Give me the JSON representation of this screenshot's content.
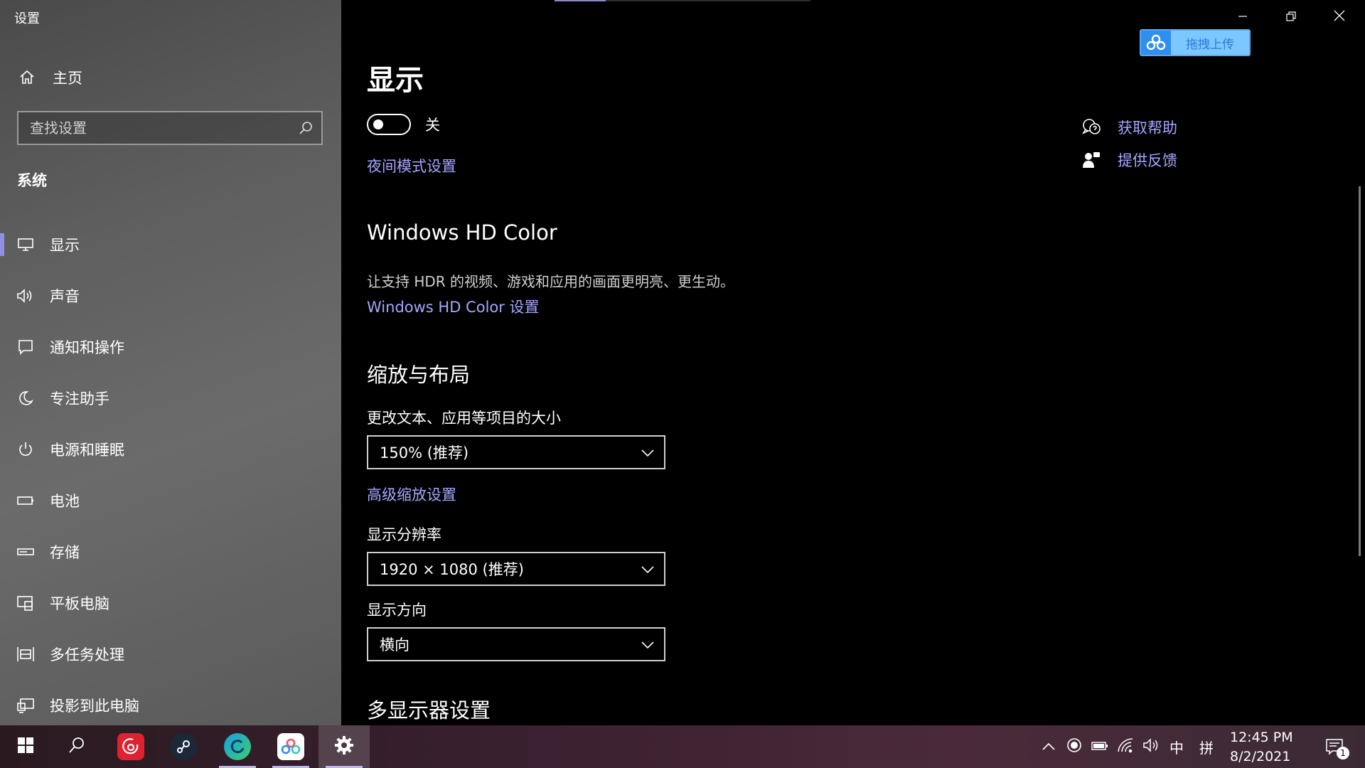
{
  "window": {
    "title": "设置",
    "minimize": "minimize-icon",
    "restore": "restore-icon",
    "close": "close-icon"
  },
  "sidebar": {
    "home": {
      "label": "主页",
      "icon": "home-icon"
    },
    "search": {
      "placeholder": "查找设置",
      "icon": "search-icon"
    },
    "section_title": "系统",
    "items": [
      {
        "label": "显示",
        "icon": "monitor-icon",
        "active": true
      },
      {
        "label": "声音",
        "icon": "speaker-icon"
      },
      {
        "label": "通知和操作",
        "icon": "notification-icon"
      },
      {
        "label": "专注助手",
        "icon": "moon-icon"
      },
      {
        "label": "电源和睡眠",
        "icon": "power-icon"
      },
      {
        "label": "电池",
        "icon": "battery-icon"
      },
      {
        "label": "存储",
        "icon": "storage-icon"
      },
      {
        "label": "平板电脑",
        "icon": "tablet-icon"
      },
      {
        "label": "多任务处理",
        "icon": "multitask-icon"
      },
      {
        "label": "投影到此电脑",
        "icon": "project-icon"
      }
    ]
  },
  "upload_widget": {
    "label": "拖拽上传",
    "icon": "cloud-upload-icon"
  },
  "main": {
    "title": "显示",
    "night_light": {
      "state": "关",
      "settings_link": "夜间模式设置"
    },
    "hd_color": {
      "heading": "Windows HD Color",
      "description": "让支持 HDR 的视频、游戏和应用的画面更明亮、更生动。",
      "link": "Windows HD Color 设置"
    },
    "scale_layout": {
      "heading": "缩放与布局",
      "scale_label": "更改文本、应用等项目的大小",
      "scale_value": "150% (推荐)",
      "advanced_link": "高级缩放设置",
      "resolution_label": "显示分辨率",
      "resolution_value": "1920 × 1080 (推荐)",
      "orientation_label": "显示方向",
      "orientation_value": "横向"
    },
    "multi_display_heading": "多显示器设置"
  },
  "help_links": [
    {
      "label": "获取帮助",
      "icon": "help-chat-icon"
    },
    {
      "label": "提供反馈",
      "icon": "feedback-icon"
    }
  ],
  "taskbar": {
    "apps": [
      "windows-start-icon",
      "search-icon",
      "netease-music-icon",
      "steam-icon",
      "edge-icon",
      "baidu-netdisk-icon",
      "settings-gear-icon"
    ],
    "tray": {
      "ime_lang": "中",
      "ime_mode": "拼",
      "time": "12:45 PM",
      "date": "8/2/2021",
      "notification_count": "1"
    },
    "accent": "#8f8fe6",
    "link_color": "#a6a6ff"
  }
}
